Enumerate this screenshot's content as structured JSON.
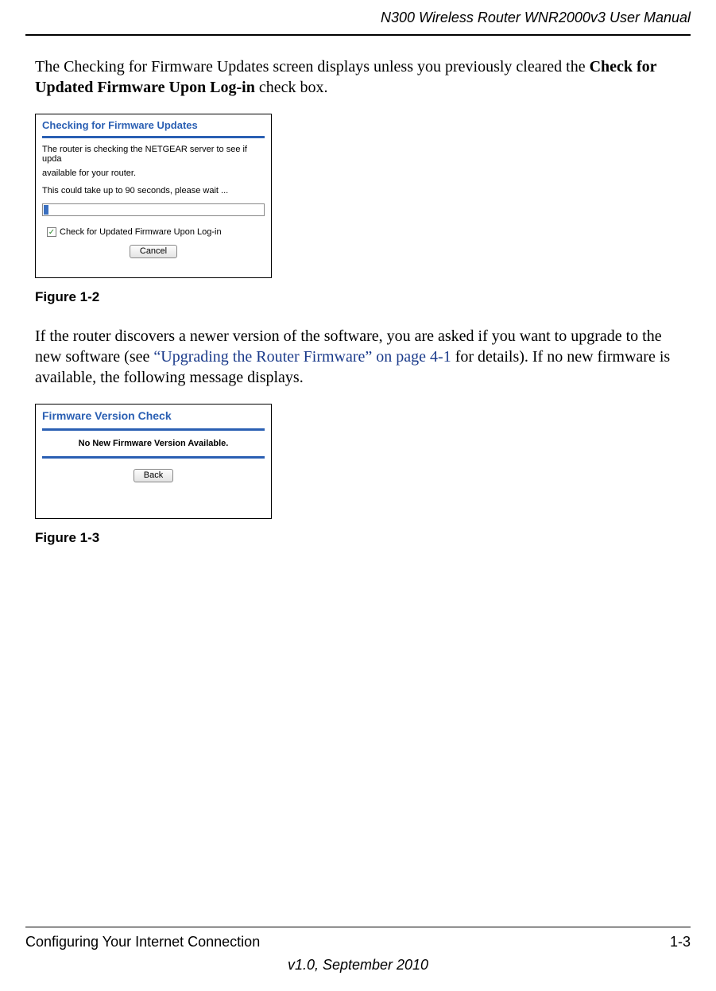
{
  "header": {
    "title": "N300 Wireless Router WNR2000v3 User Manual"
  },
  "para1": {
    "pre": "The Checking for Firmware Updates screen displays unless you previously cleared the ",
    "bold": "Check for Updated Firmware Upon Log-in",
    "post": " check box."
  },
  "figure1": {
    "title": "Checking for Firmware Updates",
    "line1": "The router is checking the NETGEAR server to see if upda",
    "line2": "available for your router.",
    "line3": "This could take up to 90 seconds, please wait ...",
    "checkbox_label": "Check for Updated Firmware Upon Log-in",
    "button": "Cancel",
    "caption": "Figure 1-2"
  },
  "para2": {
    "pre": "If the router discovers a newer version of the software, you are asked if you want to upgrade to the new software (see ",
    "link": "“Upgrading the Router Firmware” on page 4-1",
    "post": " for details). If no new firmware is available, the following message displays."
  },
  "figure2": {
    "title": "Firmware Version Check",
    "message": "No New Firmware Version Available.",
    "button": "Back",
    "caption": "Figure 1-3"
  },
  "footer": {
    "left": "Configuring Your Internet Connection",
    "right": "1-3",
    "version": "v1.0, September 2010"
  }
}
